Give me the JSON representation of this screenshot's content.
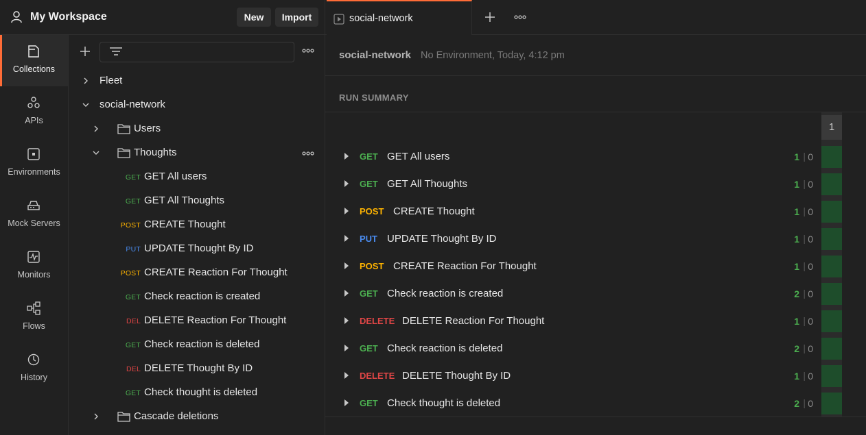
{
  "header": {
    "workspace_title": "My Workspace",
    "new_label": "New",
    "import_label": "Import"
  },
  "rail": {
    "items": [
      {
        "label": "Collections",
        "icon": "collections-icon",
        "active": true
      },
      {
        "label": "APIs",
        "icon": "apis-icon"
      },
      {
        "label": "Environments",
        "icon": "environments-icon"
      },
      {
        "label": "Mock Servers",
        "icon": "mock-servers-icon"
      },
      {
        "label": "Monitors",
        "icon": "monitors-icon"
      },
      {
        "label": "Flows",
        "icon": "flows-icon"
      },
      {
        "label": "History",
        "icon": "history-icon"
      }
    ]
  },
  "tree": {
    "collections": [
      {
        "label": "Fleet",
        "expanded": false
      },
      {
        "label": "social-network",
        "expanded": true
      }
    ],
    "folders": {
      "users": "Users",
      "thoughts": "Thoughts",
      "cascade": "Cascade deletions"
    },
    "requests": [
      {
        "method": "GET",
        "label": "GET All users"
      },
      {
        "method": "GET",
        "label": "GET All Thoughts"
      },
      {
        "method": "POST",
        "label": "CREATE Thought"
      },
      {
        "method": "PUT",
        "label": "UPDATE Thought By ID"
      },
      {
        "method": "POST",
        "label": "CREATE Reaction For Thought"
      },
      {
        "method": "GET",
        "label": "Check reaction is created"
      },
      {
        "method": "DEL",
        "label": "DELETE Reaction For Thought"
      },
      {
        "method": "GET",
        "label": "Check reaction is deleted"
      },
      {
        "method": "DEL",
        "label": "DELETE Thought By ID"
      },
      {
        "method": "GET",
        "label": "Check thought is deleted"
      }
    ]
  },
  "tab": {
    "label": "social-network"
  },
  "run": {
    "name": "social-network",
    "meta": "No Environment, Today, 4:12 pm",
    "summary_label": "RUN SUMMARY",
    "iteration": "1",
    "separator": "|",
    "results": [
      {
        "method": "GET",
        "name": "GET All users",
        "pass": "1",
        "fail": "0"
      },
      {
        "method": "GET",
        "name": "GET All Thoughts",
        "pass": "1",
        "fail": "0"
      },
      {
        "method": "POST",
        "name": "CREATE Thought",
        "pass": "1",
        "fail": "0"
      },
      {
        "method": "PUT",
        "name": "UPDATE Thought By ID",
        "pass": "1",
        "fail": "0"
      },
      {
        "method": "POST",
        "name": "CREATE Reaction For Thought",
        "pass": "1",
        "fail": "0"
      },
      {
        "method": "GET",
        "name": "Check reaction is created",
        "pass": "2",
        "fail": "0"
      },
      {
        "method": "DELETE",
        "name": "DELETE Reaction For Thought",
        "pass": "1",
        "fail": "0"
      },
      {
        "method": "GET",
        "name": "Check reaction is deleted",
        "pass": "2",
        "fail": "0"
      },
      {
        "method": "DELETE",
        "name": "DELETE Thought By ID",
        "pass": "1",
        "fail": "0"
      },
      {
        "method": "GET",
        "name": "Check thought is deleted",
        "pass": "2",
        "fail": "0"
      }
    ]
  },
  "colors": {
    "accent": "#ff6c37",
    "get": "#4caf50",
    "post": "#ffb400",
    "put": "#4a8cf0",
    "delete": "#e04646",
    "pass_cell": "#1e4d2b"
  }
}
